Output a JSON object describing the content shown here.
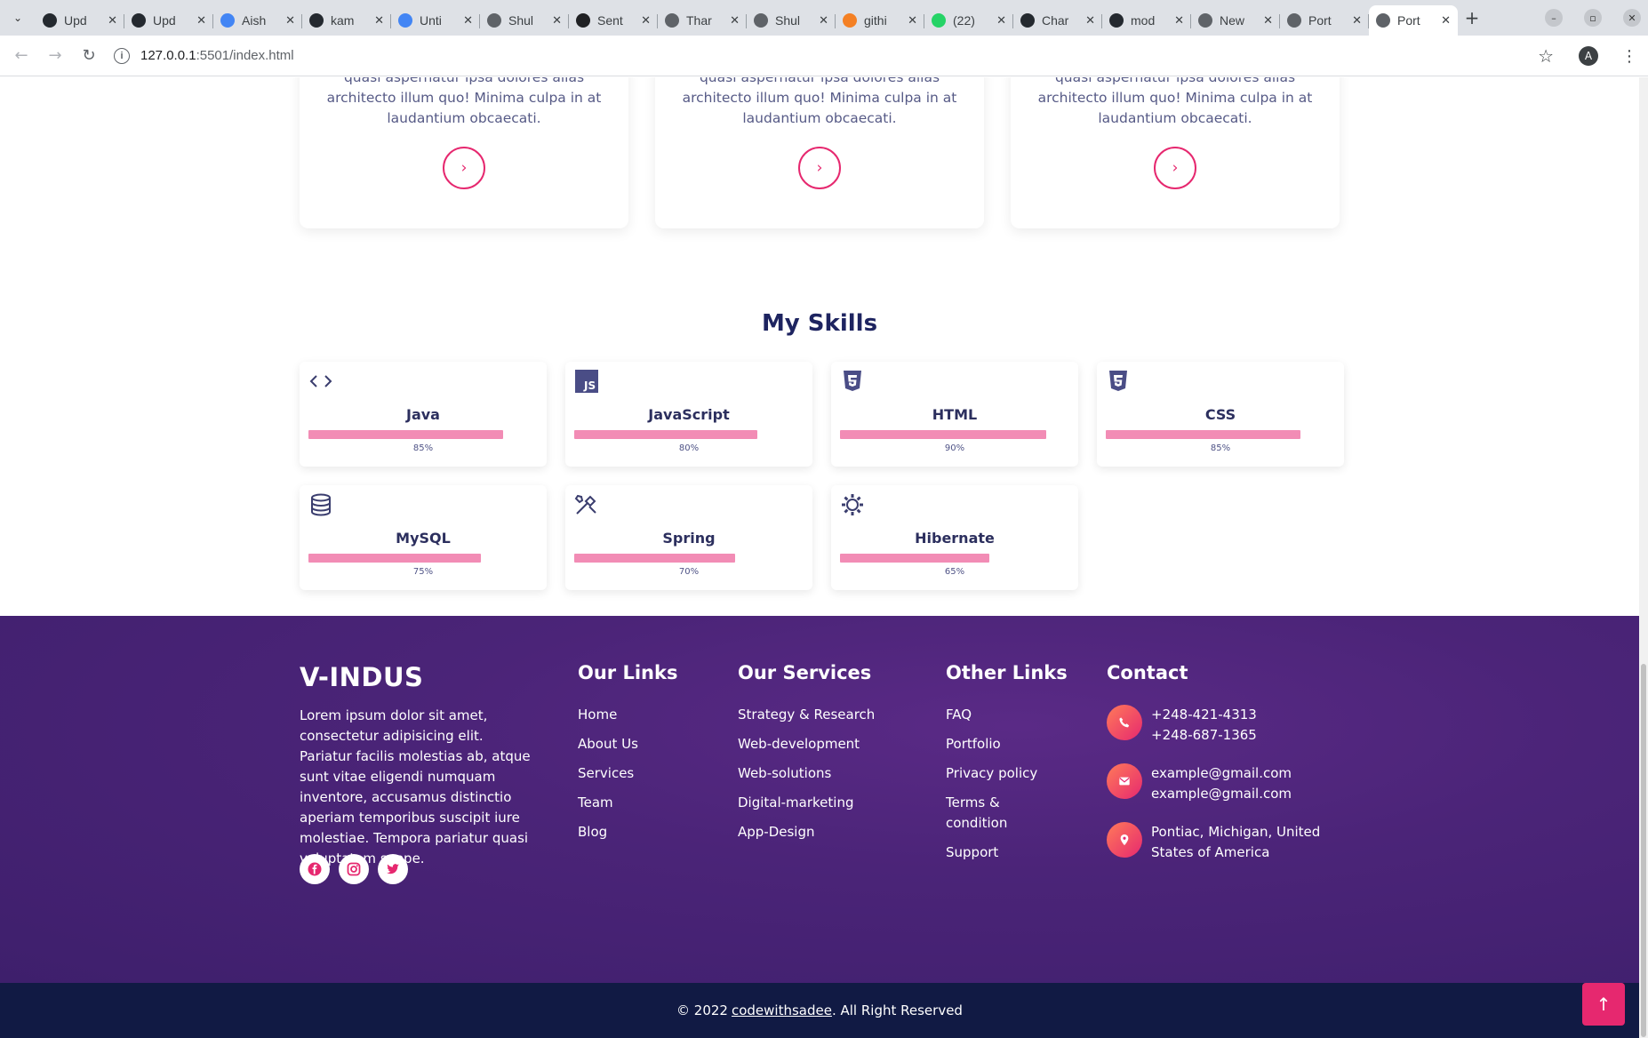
{
  "browser": {
    "tabs": [
      {
        "label": "Upd",
        "fav_color": "#24292f"
      },
      {
        "label": "Upd",
        "fav_color": "#24292f"
      },
      {
        "label": "Aish",
        "fav_color": "#4285f4"
      },
      {
        "label": "kam",
        "fav_color": "#24292f"
      },
      {
        "label": "Unti",
        "fav_color": "#4285f4"
      },
      {
        "label": "Shul",
        "fav_color": "#5f6368"
      },
      {
        "label": "Sent",
        "fav_color": "#202124"
      },
      {
        "label": "Thar",
        "fav_color": "#5f6368"
      },
      {
        "label": "Shul",
        "fav_color": "#5f6368"
      },
      {
        "label": "githi",
        "fav_color": "#f48024"
      },
      {
        "label": "(22)",
        "fav_color": "#25d366"
      },
      {
        "label": "Char",
        "fav_color": "#24292f"
      },
      {
        "label": "mod",
        "fav_color": "#24292f"
      },
      {
        "label": "New",
        "fav_color": "#5f6368"
      },
      {
        "label": "Port",
        "fav_color": "#5f6368"
      },
      {
        "label": "Port",
        "fav_color": "#5f6368",
        "active": true
      }
    ],
    "url_host": "127.0.0.1",
    "url_path": ":5501/index.html",
    "profile_initial": "A"
  },
  "services": [
    {
      "desc": "quasi aspernatur ipsa dolores alias architecto illum quo! Minima culpa in at laudantium obcaecati."
    },
    {
      "desc": "quasi aspernatur ipsa dolores alias architecto illum quo! Minima culpa in at laudantium obcaecati."
    },
    {
      "desc": "quasi aspernatur ipsa dolores alias architecto illum quo! Minima culpa in at laudantium obcaecati."
    }
  ],
  "skills": {
    "title": "My Skills",
    "items": [
      {
        "name": "Java",
        "percent_label": "85%",
        "level": 0.85,
        "icon": "code-icon"
      },
      {
        "name": "JavaScript",
        "percent_label": "80%",
        "level": 0.8,
        "icon": "js-icon"
      },
      {
        "name": "HTML",
        "percent_label": "90%",
        "level": 0.9,
        "icon": "html5-icon"
      },
      {
        "name": "CSS",
        "percent_label": "85%",
        "level": 0.85,
        "icon": "css3-icon"
      },
      {
        "name": "MySQL",
        "percent_label": "75%",
        "level": 0.75,
        "icon": "database-icon"
      },
      {
        "name": "Spring",
        "percent_label": "70%",
        "level": 0.7,
        "icon": "tools-icon"
      },
      {
        "name": "Hibernate",
        "percent_label": "65%",
        "level": 0.65,
        "icon": "gear-icon"
      }
    ]
  },
  "footer": {
    "brand": "V-INDUS",
    "about": "Lorem ipsum dolor sit amet, consectetur adipisicing elit. Pariatur facilis molestias ab, atque sunt vitae eligendi numquam inventore, accusamus distinctio aperiam temporibus suscipit iure molestiae. Tempora pariatur quasi voluptatem saepe.",
    "our_links": {
      "title": "Our Links",
      "items": [
        "Home",
        "About Us",
        "Services",
        "Team",
        "Blog"
      ]
    },
    "our_services": {
      "title": "Our Services",
      "items": [
        "Strategy & Research",
        "Web-development",
        "Web-solutions",
        "Digital-marketing",
        "App-Design"
      ]
    },
    "other_links": {
      "title": "Other Links",
      "items": [
        "FAQ",
        "Portfolio",
        "Privacy policy",
        "Terms & condition",
        "Support"
      ]
    },
    "contact": {
      "title": "Contact",
      "phone1": "+248-421-4313",
      "phone2": "+248-687-1365",
      "email1": "example@gmail.com",
      "email2": "example@gmail.com",
      "address": "Pontiac, Michigan, United States of America"
    },
    "copyright_prefix": "© 2022",
    "copyright_link": "codewithsadee",
    "copyright_suffix": ". All Right Reserved"
  },
  "colors": {
    "accent": "#e6286f",
    "footer_bg": "#4b2478",
    "bar": "#f28cb5",
    "bottom_bar": "#111a44"
  }
}
